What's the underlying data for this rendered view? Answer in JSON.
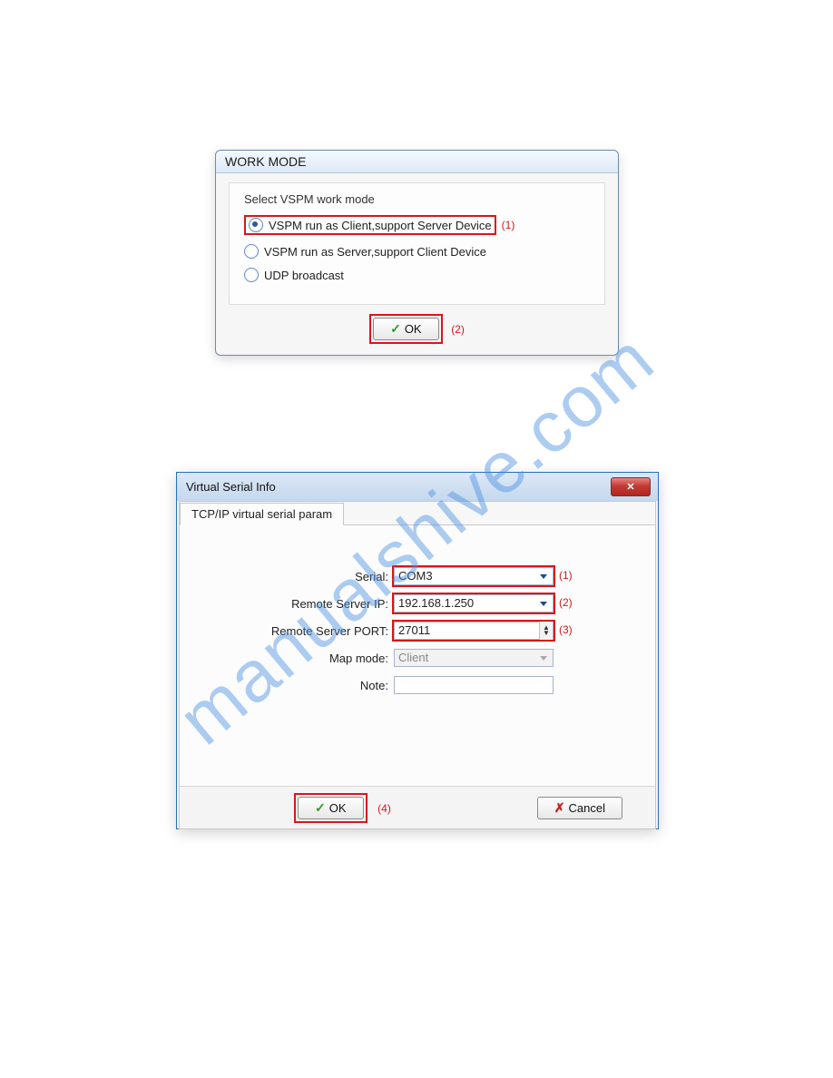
{
  "watermark": "manualshive.com",
  "dialog1": {
    "title": "WORK MODE",
    "group_title": "Select VSPM work mode",
    "options": {
      "opt1": "VSPM run as Client,support Server Device",
      "opt2": "VSPM run as Server,support Client Device",
      "opt3": "UDP broadcast"
    },
    "ok_label": "OK",
    "ann1": "(1)",
    "ann2": "(2)"
  },
  "dialog2": {
    "title": "Virtual Serial Info",
    "tab_label": "TCP/IP virtual serial param",
    "fields": {
      "serial_label": "Serial:",
      "serial_value": "COM3",
      "ip_label": "Remote Server IP:",
      "ip_value": "192.168.1.250",
      "port_label": "Remote Server PORT:",
      "port_value": "27011",
      "mapmode_label": "Map mode:",
      "mapmode_value": "Client",
      "note_label": "Note:",
      "note_value": ""
    },
    "ok_label": "OK",
    "cancel_label": "Cancel",
    "ann1": "(1)",
    "ann2": "(2)",
    "ann3": "(3)",
    "ann4": "(4)"
  }
}
